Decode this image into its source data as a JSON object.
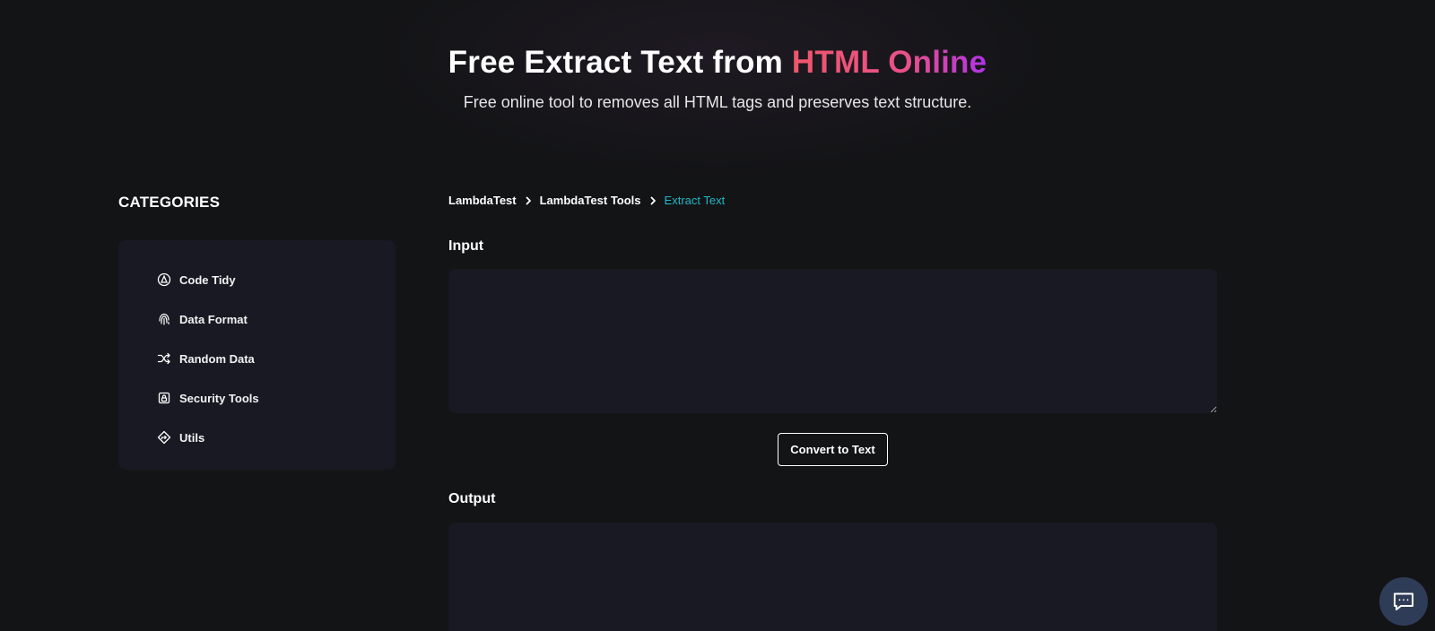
{
  "hero": {
    "title_main": "Free Extract Text from ",
    "title_accent": "HTML Online",
    "subtitle": "Free online tool to removes all HTML tags and preserves text structure."
  },
  "sidebar": {
    "title": "CATEGORIES",
    "items": [
      {
        "label": "Code Tidy",
        "icon": "code-tidy-icon"
      },
      {
        "label": "Data Format",
        "icon": "fingerprint-icon"
      },
      {
        "label": "Random Data",
        "icon": "shuffle-icon"
      },
      {
        "label": "Security Tools",
        "icon": "lock-icon"
      },
      {
        "label": "Utils",
        "icon": "diamond-arrow-icon"
      }
    ]
  },
  "breadcrumb": {
    "items": [
      "LambdaTest",
      "LambdaTest Tools"
    ],
    "current": "Extract Text"
  },
  "input": {
    "label": "Input",
    "value": "",
    "placeholder": ""
  },
  "convert_button": {
    "label": "Convert to Text"
  },
  "output": {
    "label": "Output",
    "value": ""
  },
  "colors": {
    "background": "#131416",
    "panel": "#181922",
    "accent_start": "#f0566a",
    "accent_end": "#b032e8",
    "breadcrumb_current": "#1fb8c8",
    "chat_button": "#2f3c57"
  }
}
